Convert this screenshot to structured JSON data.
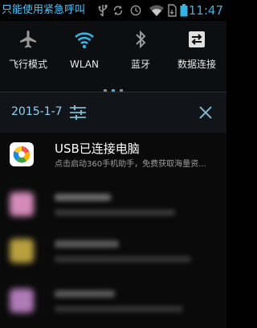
{
  "status_bar": {
    "carrier_text": "只能使用紧急呼叫",
    "time": "11:47",
    "icons": [
      "usb-icon",
      "sync-icon",
      "clock-icon",
      "wifi-icon",
      "sim-icon",
      "battery-icon"
    ]
  },
  "quick_settings": {
    "toggles": [
      {
        "label": "飞行模式",
        "icon": "airplane-icon",
        "active": false
      },
      {
        "label": "WLAN",
        "icon": "wifi-icon",
        "active": true
      },
      {
        "label": "蓝牙",
        "icon": "bluetooth-icon",
        "active": false
      },
      {
        "label": "数据连接",
        "icon": "data-transfer-icon",
        "active": false
      }
    ],
    "pages": 3,
    "active_page": 2
  },
  "header": {
    "date": "2015-1-7",
    "settings_icon": "sliders-icon",
    "clear_icon": "close-icon"
  },
  "notifications": [
    {
      "title": "USB已连接电脑",
      "body": "点击启动360手机助手，免费获取海量资..."
    },
    {
      "title": "",
      "body": ""
    },
    {
      "title": "",
      "body": ""
    },
    {
      "title": "",
      "body": ""
    }
  ],
  "overlay_text": "",
  "colors": {
    "accent": "#33b5e5",
    "background": "#000000",
    "text": "#ffffff"
  }
}
